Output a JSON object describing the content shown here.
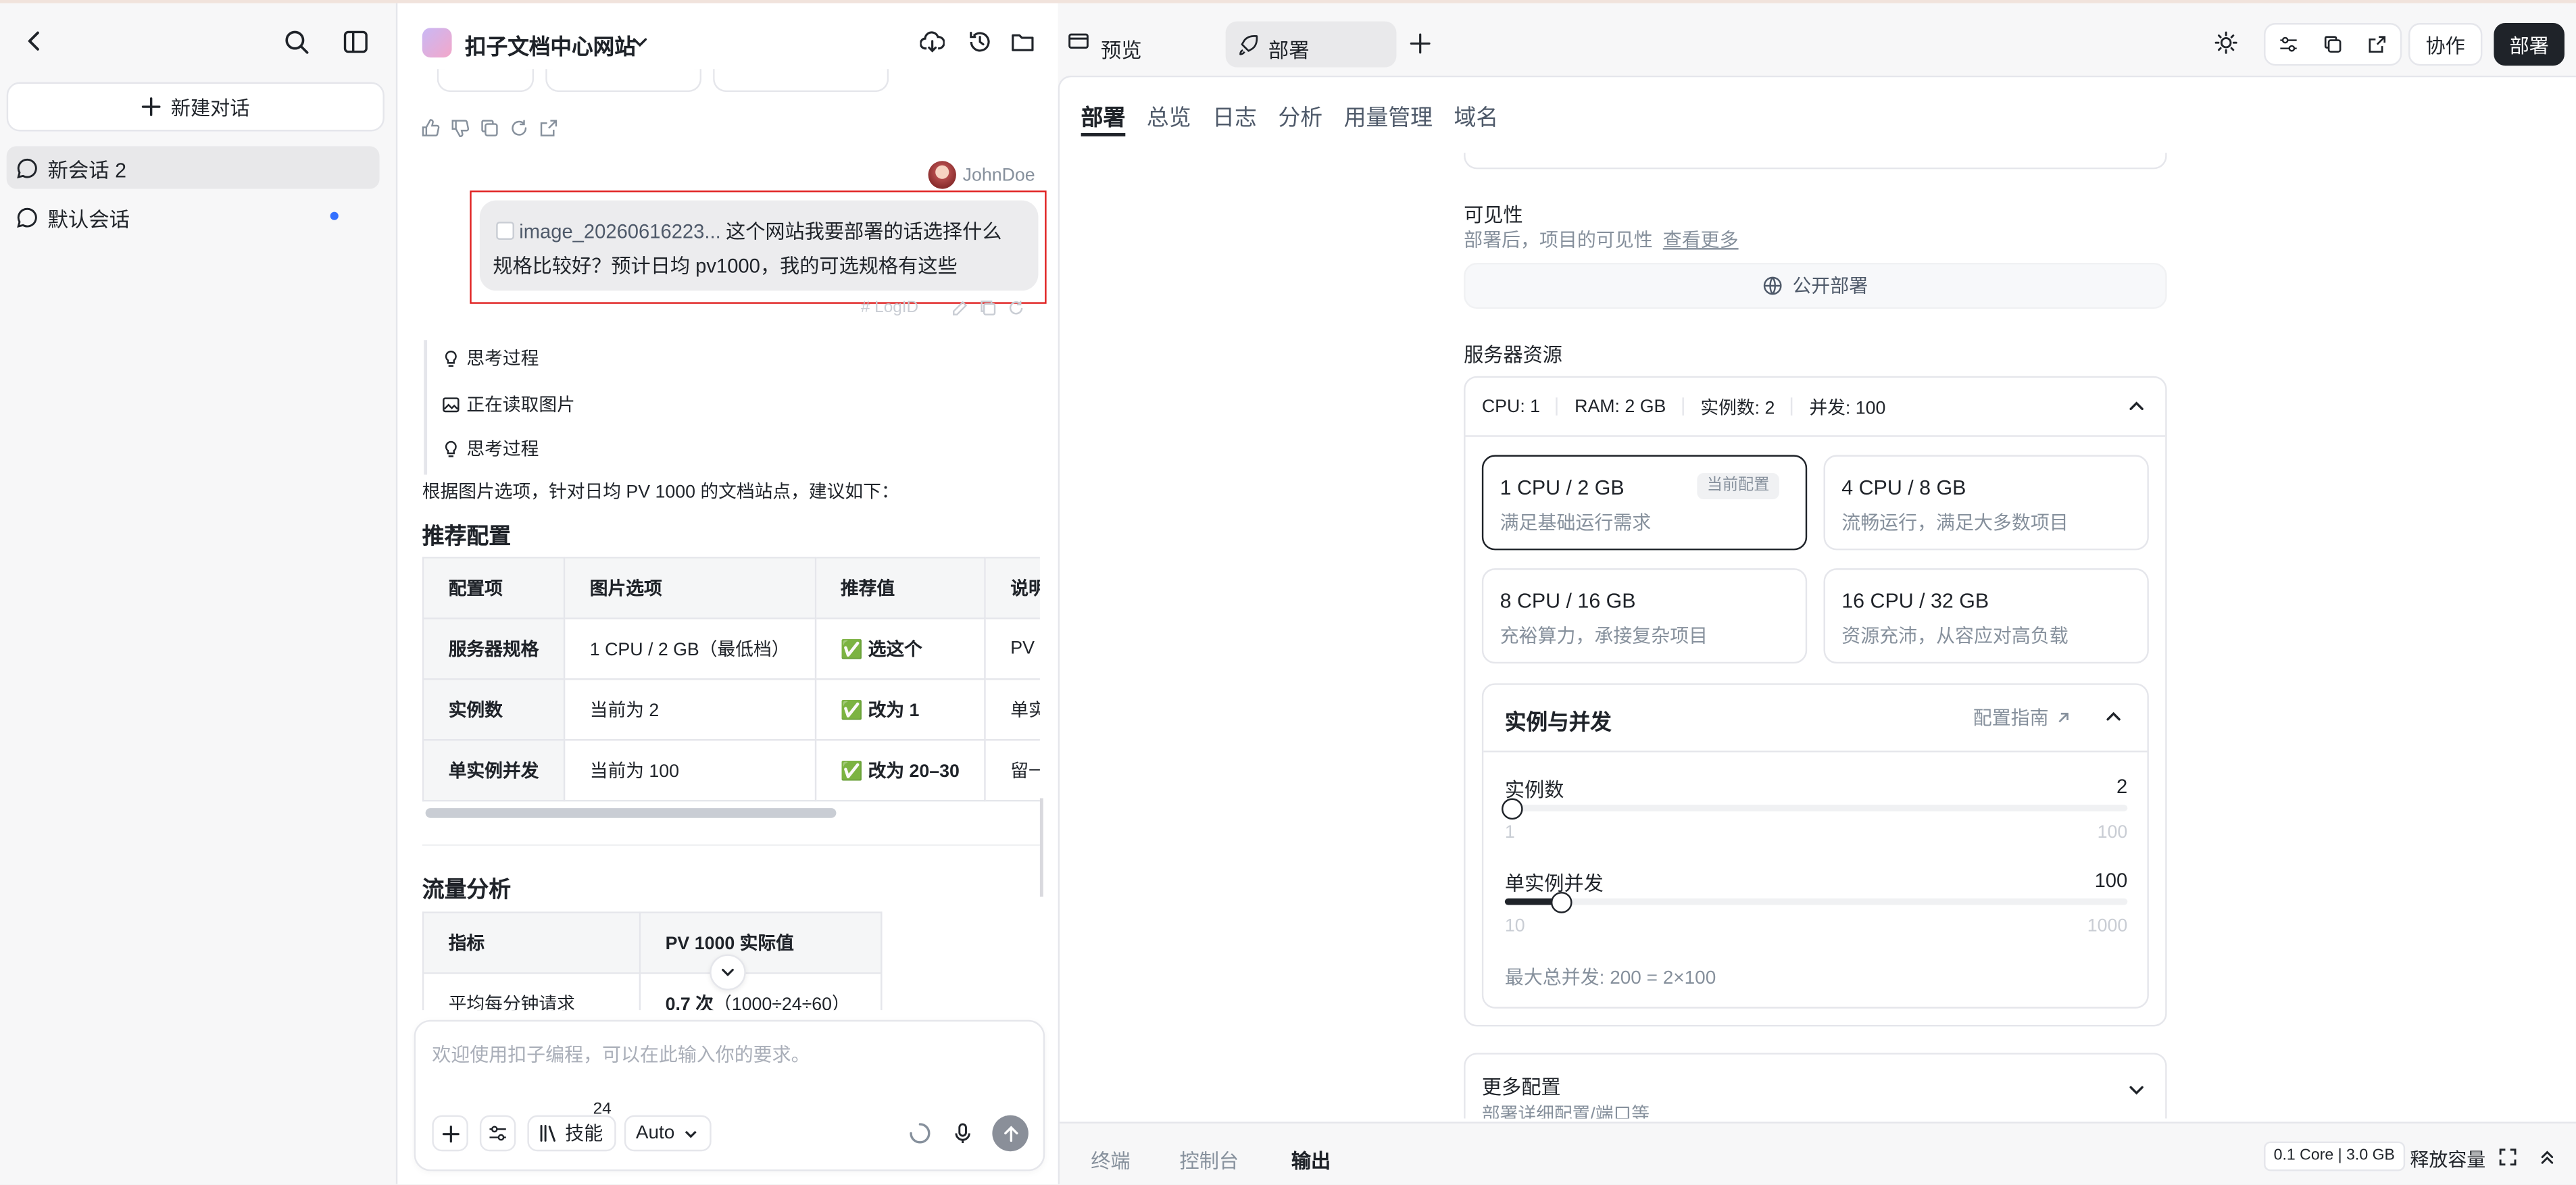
{
  "header": {
    "project_title": "扣子文档中心网站",
    "tab_preview": "预览",
    "tab_deploy": "部署",
    "collaborate": "协作",
    "deploy": "部署"
  },
  "sidebar": {
    "new_chat": "新建对话",
    "conversations": [
      {
        "label": "新会话 2"
      },
      {
        "label": "默认会话"
      }
    ]
  },
  "chat": {
    "user_name": "JohnDoe",
    "user_message_file": "image_20260616223...",
    "user_message_line1": "这个网站我要部署的话选择什么",
    "user_message_line2": "规格比较好？预计日均 pv1000，我的可选规格有这些",
    "logid": "LogID",
    "steps": [
      "思考过程",
      "正在读取图片",
      "思考过程"
    ],
    "intro": "根据图片选项，针对日均 PV 1000 的文档站点，建议如下：",
    "section1_title": "推荐配置",
    "table1": {
      "headers": [
        "配置项",
        "图片选项",
        "推荐值",
        "说明"
      ],
      "rows": [
        [
          "服务器规格",
          "1 CPU / 2 GB（最低档）",
          "✅ 选这个",
          "PV"
        ],
        [
          "实例数",
          "当前为 2",
          "✅ 改为 1",
          "单实"
        ],
        [
          "单实例并发",
          "当前为 100",
          "✅ 改为 20–30",
          "留一"
        ]
      ]
    },
    "section2_title": "流量分析",
    "table2": {
      "headers": [
        "指标",
        "PV 1000 实际值"
      ],
      "row_label": "平均每分钟请求",
      "row_value_bold": "0.7 次",
      "row_value_rest": "（1000÷24÷60）"
    },
    "input_placeholder": "欢迎使用扣子编程，可以在此输入你的要求。",
    "skills_label": "技能",
    "skills_count": "24",
    "model_select": "Auto"
  },
  "deploy_panel": {
    "tabs": [
      "部署",
      "总览",
      "日志",
      "分析",
      "用量管理",
      "域名"
    ],
    "visibility_title": "可见性",
    "visibility_desc": "部署后，项目的可见性",
    "visibility_link": "查看更多",
    "public_deploy": "公开部署",
    "server_title": "服务器资源",
    "summary": {
      "cpu": "CPU: 1",
      "ram": "RAM: 2 GB",
      "instances": "实例数: 2",
      "concurrency": "并发: 100"
    },
    "specs": [
      {
        "title": "1 CPU / 2 GB",
        "desc": "满足基础运行需求",
        "badge": "当前配置"
      },
      {
        "title": "4 CPU / 8 GB",
        "desc": "流畅运行，满足大多数项目"
      },
      {
        "title": "8 CPU / 16 GB",
        "desc": "充裕算力，承接复杂项目"
      },
      {
        "title": "16 CPU / 32 GB",
        "desc": "资源充沛，从容应对高负载"
      }
    ],
    "instances_section": {
      "title": "实例与并发",
      "guide": "配置指南",
      "instance_label": "实例数",
      "instance_value": "2",
      "instance_min": "1",
      "instance_max": "100",
      "concurrency_label": "单实例并发",
      "concurrency_value": "100",
      "concurrency_min": "10",
      "concurrency_max": "1000",
      "max_total": "最大总并发: 200 = 2×100"
    },
    "more_config": "更多配置",
    "more_config_sub": "部署详细配置/端口等"
  },
  "bottom_bar": {
    "tabs": [
      "终端",
      "控制台",
      "输出"
    ],
    "resource": "0.1 Core | 3.0 GB",
    "release": "释放容量"
  },
  "colors": {
    "accent_dark": "#1f2329",
    "highlight_red": "#e02020",
    "unread_dot": "#3370ff"
  }
}
